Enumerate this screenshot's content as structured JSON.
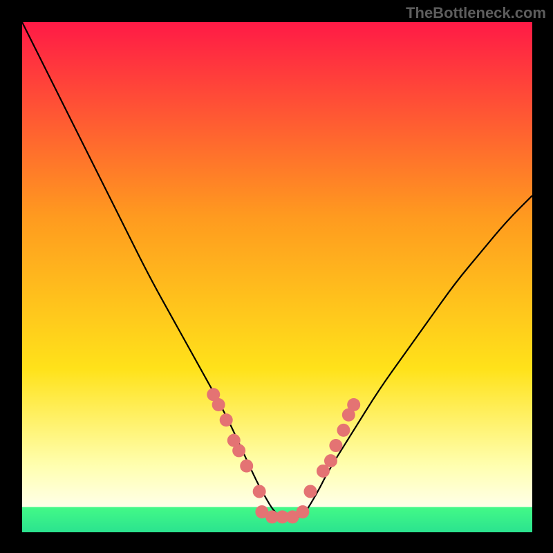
{
  "branding": "TheBottleneck.com",
  "colors": {
    "bg_outer": "#000000",
    "curve": "#000000",
    "markers": "#e47373",
    "bottom_strip": "#43f987",
    "gradient_top": "#ff1a46",
    "gradient_mid1": "#ff7a1f",
    "gradient_mid2": "#ffe21a",
    "gradient_low": "#ffffb0"
  },
  "chart_data": {
    "type": "line",
    "title": "",
    "xlabel": "",
    "ylabel": "",
    "xlim": [
      0,
      100
    ],
    "ylim": [
      0,
      100
    ],
    "curve": {
      "x": [
        0,
        5,
        10,
        15,
        20,
        25,
        30,
        35,
        40,
        45,
        47,
        50,
        53,
        55,
        58,
        60,
        65,
        70,
        75,
        80,
        85,
        90,
        95,
        100
      ],
      "values": [
        100,
        90,
        80,
        70,
        60,
        50,
        41,
        32,
        23,
        12,
        8,
        3,
        3,
        3,
        8,
        12,
        20,
        28,
        35,
        42,
        49,
        55,
        61,
        66
      ]
    },
    "markers": [
      {
        "x": 37.5,
        "y": 27
      },
      {
        "x": 38.5,
        "y": 25
      },
      {
        "x": 40.0,
        "y": 22
      },
      {
        "x": 41.5,
        "y": 18
      },
      {
        "x": 42.5,
        "y": 16
      },
      {
        "x": 44.0,
        "y": 13
      },
      {
        "x": 46.5,
        "y": 8
      },
      {
        "x": 47.0,
        "y": 4
      },
      {
        "x": 49.0,
        "y": 3
      },
      {
        "x": 51.0,
        "y": 3
      },
      {
        "x": 53.0,
        "y": 3
      },
      {
        "x": 55.0,
        "y": 4
      },
      {
        "x": 56.5,
        "y": 8
      },
      {
        "x": 59.0,
        "y": 12
      },
      {
        "x": 60.5,
        "y": 14
      },
      {
        "x": 61.5,
        "y": 17
      },
      {
        "x": 63.0,
        "y": 20
      },
      {
        "x": 64.0,
        "y": 23
      },
      {
        "x": 65.0,
        "y": 25
      }
    ]
  }
}
